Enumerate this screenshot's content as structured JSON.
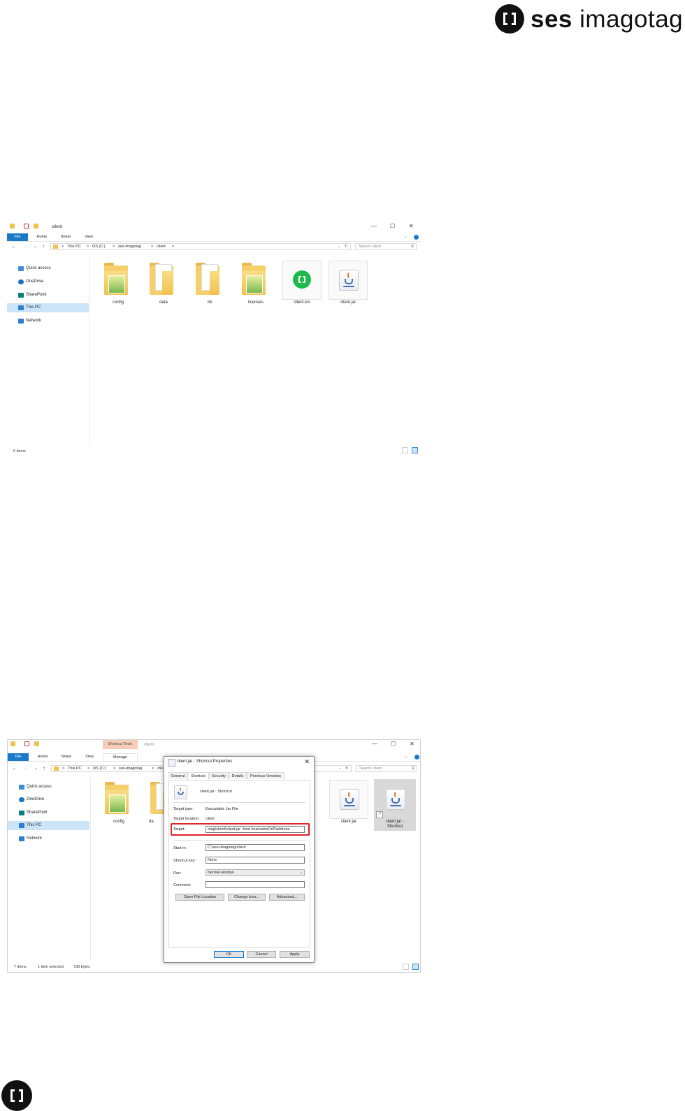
{
  "brand": {
    "bold": "ses",
    "light": "imagotag"
  },
  "shot1": {
    "window_title": "client",
    "tabs": [
      "File",
      "Home",
      "Share",
      "View"
    ],
    "breadcrumb": [
      ">",
      "This PC",
      ">",
      "OS (C:)",
      ">",
      "ses-imagotag",
      ">",
      "client",
      ">"
    ],
    "search_placeholder": "Search client",
    "nav": [
      "Quick access",
      "OneDrive",
      "SharePoint",
      "This PC",
      "Network"
    ],
    "items": [
      "config",
      "data",
      "lib",
      "licenses",
      "client.ico",
      "client.jar"
    ],
    "status": "6 items"
  },
  "shot2": {
    "window_title": "client",
    "contextual_group": "Shortcut Tools",
    "tabs": [
      "File",
      "Home",
      "Share",
      "View",
      "Manage"
    ],
    "breadcrumb": [
      ">",
      "This PC",
      ">",
      "OS (C:)",
      ">",
      "ses-imagotag",
      ">",
      "clie"
    ],
    "search_placeholder": "Search client",
    "nav": [
      "Quick access",
      "OneDrive",
      "SharePoint",
      "This PC",
      "Network"
    ],
    "items": [
      "config",
      "da",
      "client.jar",
      "client.jar -\nShortcut"
    ],
    "status_count": "7 items",
    "status_selected": "1 item selected",
    "status_size": "738 bytes"
  },
  "dialog": {
    "title": "client.jar - Shortcut Properties",
    "tabs": [
      "General",
      "Shortcut",
      "Security",
      "Details",
      "Previous Versions"
    ],
    "name": "client.jar - Shortcut",
    "target_type_label": "Target type:",
    "target_type": "Executable Jar File",
    "target_location_label": "Target location:",
    "target_location": "client",
    "target_label": "Target:",
    "target": "otag\\client\\client.jar -host hostnameOrIPaddress",
    "start_in_label": "Start in:",
    "start_in": "C:\\ses-imagotag\\client",
    "shortcut_key_label": "Shortcut key:",
    "shortcut_key": "None",
    "run_label": "Run:",
    "run": "Normal window",
    "comment_label": "Comment:",
    "comment": "",
    "buttons": [
      "Open File Location",
      "Change Icon...",
      "Advanced..."
    ],
    "footer": [
      "OK",
      "Cancel",
      "Apply"
    ]
  },
  "colors": {
    "file_tab": "#1979ca",
    "selection": "#cce4f7",
    "highlight": "#e0252b",
    "ico_green": "#1dba4a",
    "brand": "#111111"
  }
}
